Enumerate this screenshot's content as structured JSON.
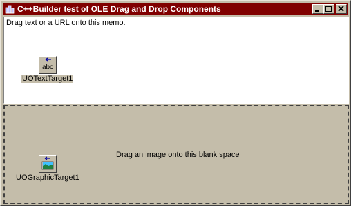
{
  "window": {
    "title": "C++Builder test of OLE Drag and Drop Components",
    "icon": "cbuilder-app-icon",
    "controls": [
      "minimize",
      "maximize",
      "close"
    ]
  },
  "memo": {
    "text": "Drag text or a URL onto this memo."
  },
  "text_target": {
    "icon": "abc-text-icon",
    "icon_text": "abc",
    "label": "UOTextTarget1"
  },
  "graphic_target": {
    "icon": "image-drop-icon",
    "label": "UOGraphicTarget1"
  },
  "drop_zone": {
    "text": "Drag an image onto this blank space"
  },
  "colors": {
    "titlebar": "#800000",
    "face": "#c4bdaa",
    "memo_bg": "#ffffff"
  }
}
